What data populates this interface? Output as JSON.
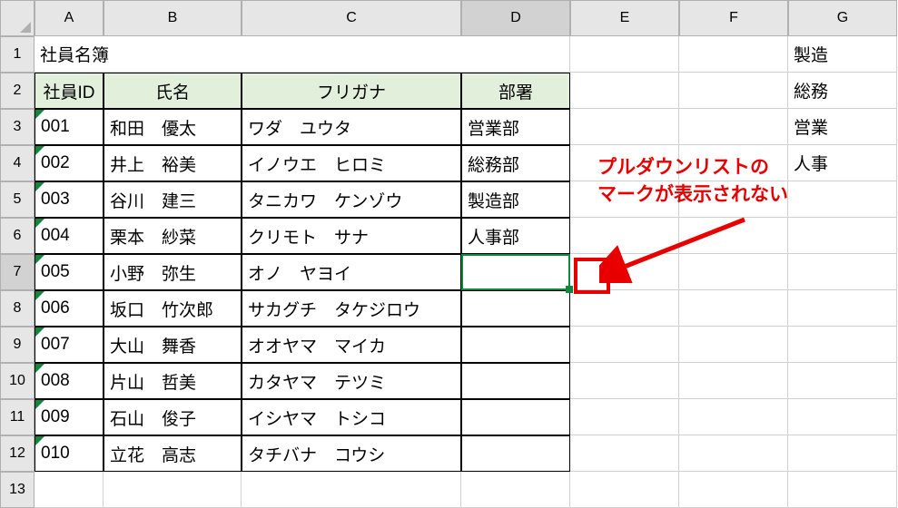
{
  "cols": [
    "A",
    "B",
    "C",
    "D",
    "E",
    "F",
    "G"
  ],
  "rows": [
    "1",
    "2",
    "3",
    "4",
    "5",
    "6",
    "7",
    "8",
    "9",
    "10",
    "11",
    "12",
    "13"
  ],
  "title": "社員名簿",
  "headers": {
    "a": "社員ID",
    "b": "氏名",
    "c": "フリガナ",
    "d": "部署"
  },
  "data": [
    {
      "id": "001",
      "name": "和田　優太",
      "kana": "ワダ　ユウタ",
      "dept": "営業部"
    },
    {
      "id": "002",
      "name": "井上　裕美",
      "kana": "イノウエ　ヒロミ",
      "dept": "総務部"
    },
    {
      "id": "003",
      "name": "谷川　建三",
      "kana": "タニカワ　ケンゾウ",
      "dept": "製造部"
    },
    {
      "id": "004",
      "name": "栗本　紗菜",
      "kana": "クリモト　サナ",
      "dept": "人事部"
    },
    {
      "id": "005",
      "name": "小野　弥生",
      "kana": "オノ　ヤヨイ",
      "dept": ""
    },
    {
      "id": "006",
      "name": "坂口　竹次郎",
      "kana": "サカグチ　タケジロウ",
      "dept": ""
    },
    {
      "id": "007",
      "name": "大山　舞香",
      "kana": "オオヤマ　マイカ",
      "dept": ""
    },
    {
      "id": "008",
      "name": "片山　哲美",
      "kana": "カタヤマ　テツミ",
      "dept": ""
    },
    {
      "id": "009",
      "name": "石山　俊子",
      "kana": "イシヤマ　トシコ",
      "dept": ""
    },
    {
      "id": "010",
      "name": "立花　高志",
      "kana": "タチバナ　コウシ",
      "dept": ""
    }
  ],
  "list": [
    "製造",
    "総務",
    "営業",
    "人事"
  ],
  "annotation": "プルダウンリストの\nマークが表示されない"
}
